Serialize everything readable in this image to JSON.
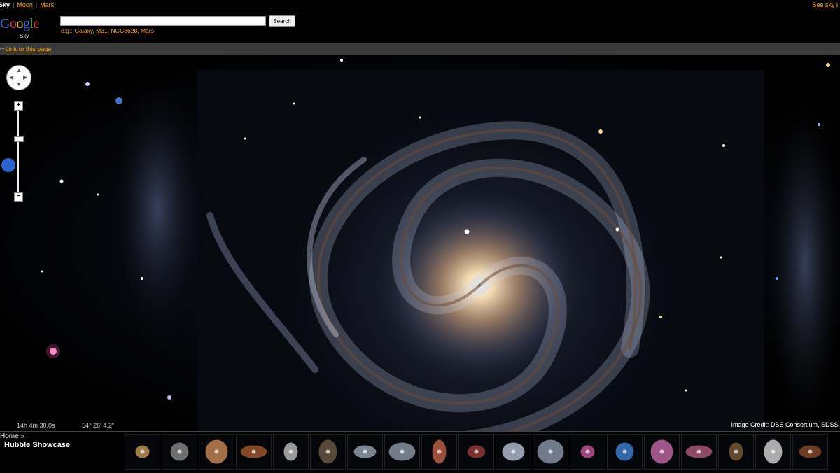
{
  "nav": {
    "current": "Sky",
    "links": [
      "Moon",
      "Mars"
    ],
    "right_link": "See sky i"
  },
  "logo": {
    "word": "Google",
    "sub": "Sky"
  },
  "search": {
    "value": "",
    "button": "Search",
    "examples_prefix": "e.g.:",
    "examples": [
      "Galaxy",
      "M31",
      "NGC3628",
      "Mars"
    ]
  },
  "linkbar": {
    "label": "Link to this page"
  },
  "controls": {
    "zoom_in": "+",
    "zoom_out": "−",
    "zoom_level": 0.6
  },
  "coords": {
    "ra": "14h 4m 30.0s",
    "dec": "54° 26' 4.2\""
  },
  "credit": "Image Credit: DSS Consortium, SDSS,",
  "bottom": {
    "home": "Home »",
    "title": "Hubble Showcase",
    "thumbnails": [
      {
        "icon": "nebula-icon",
        "color": "#c79a5a"
      },
      {
        "icon": "galaxy-icon",
        "color": "#8a8a8a"
      },
      {
        "icon": "galaxy-pair-icon",
        "color": "#cc8a55"
      },
      {
        "icon": "nebula-icon",
        "color": "#a5592e"
      },
      {
        "icon": "edge-on-galaxy-icon",
        "color": "#bfbfbf"
      },
      {
        "icon": "star-field-icon",
        "color": "#6b5a45"
      },
      {
        "icon": "star-cluster-icon",
        "color": "#9aa4b5"
      },
      {
        "icon": "star-cluster-icon",
        "color": "#8e98a8"
      },
      {
        "icon": "galaxy-icon",
        "color": "#c0624a"
      },
      {
        "icon": "nebula-icon",
        "color": "#9a3a3a"
      },
      {
        "icon": "spiral-galaxy-icon",
        "color": "#b8c2d6"
      },
      {
        "icon": "spiral-galaxy-icon",
        "color": "#8c98ad"
      },
      {
        "icon": "nebula-icon",
        "color": "#c0589a"
      },
      {
        "icon": "crab-nebula-icon",
        "color": "#3d7fcf"
      },
      {
        "icon": "nebula-icon",
        "color": "#c46aa8"
      },
      {
        "icon": "supernova-remnant-icon",
        "color": "#b05a7a"
      },
      {
        "icon": "star-field-icon",
        "color": "#7b5a3a"
      },
      {
        "icon": "galaxy-icon",
        "color": "#d6d6d6"
      },
      {
        "icon": "star-field-icon",
        "color": "#8a4a2a"
      }
    ]
  }
}
